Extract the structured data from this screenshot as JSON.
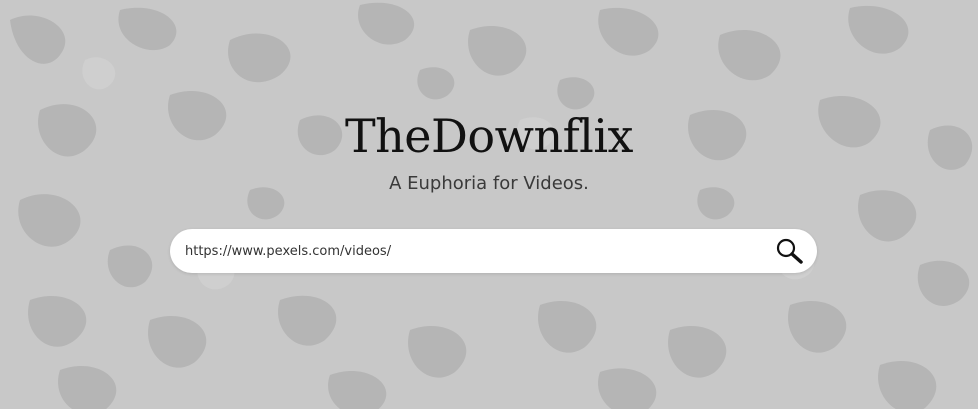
{
  "brand": {
    "title": "TheDownflix",
    "tagline": "A Euphoria for Videos."
  },
  "search": {
    "value": "https://www.pexels.com/videos/",
    "icon": "search-icon"
  },
  "colors": {
    "background": "#c8c8c8",
    "pattern": "#b4b4b4",
    "search_bar": "#ffffff",
    "title_text": "#111111"
  }
}
